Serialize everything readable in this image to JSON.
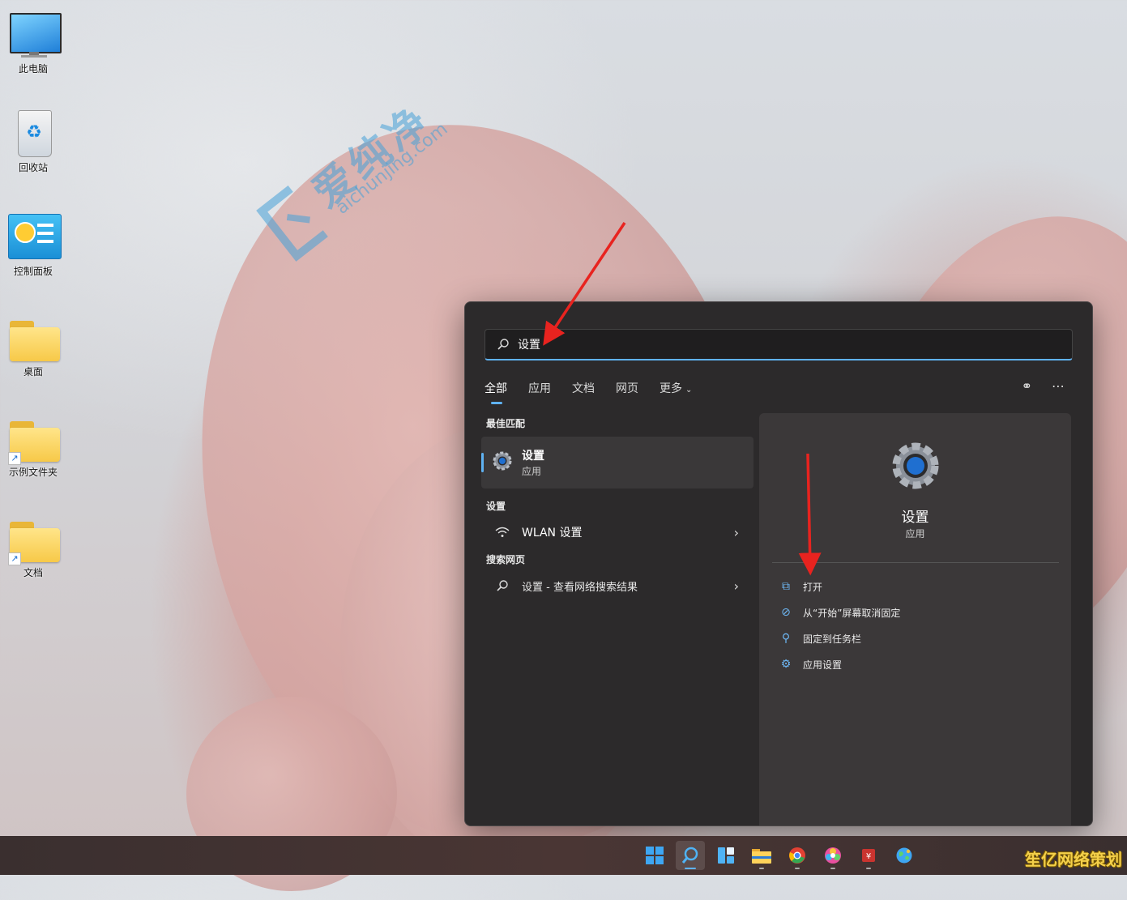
{
  "desktop": {
    "icons": [
      {
        "label": "此电脑",
        "icon": "monitor-icon"
      },
      {
        "label": "回收站",
        "icon": "recycle-bin-icon"
      },
      {
        "label": "控制面板",
        "icon": "control-panel-icon"
      },
      {
        "label": "桌面",
        "icon": "folder-icon"
      },
      {
        "label": "示例文件夹",
        "icon": "folder-shortcut-icon"
      },
      {
        "label": "文档",
        "icon": "folder-shortcut-icon"
      }
    ]
  },
  "watermark": {
    "title": "爱纯净",
    "subtitle": "aichunjing.com"
  },
  "search": {
    "query": "设置",
    "tabs": [
      "全部",
      "应用",
      "文档",
      "网页",
      "更多"
    ],
    "active_tab": "全部",
    "sections": {
      "best_match": {
        "heading": "最佳匹配",
        "title": "设置",
        "subtitle": "应用"
      },
      "settings": {
        "heading": "设置",
        "item": "WLAN 设置"
      },
      "web": {
        "heading": "搜索网页",
        "item": "设置 - 查看网络搜索结果"
      }
    },
    "detail": {
      "title": "设置",
      "subtitle": "应用",
      "actions": [
        {
          "label": "打开",
          "icon": "open-external-icon"
        },
        {
          "label": "从“开始”屏幕取消固定",
          "icon": "unpin-icon"
        },
        {
          "label": "固定到任务栏",
          "icon": "pin-icon"
        },
        {
          "label": "应用设置",
          "icon": "gear-icon"
        }
      ]
    }
  },
  "taskbar": {
    "icons": [
      "windows-start-icon",
      "search-icon",
      "widgets-icon",
      "file-explorer-icon",
      "chrome-icon",
      "photos-icon",
      "app-icon",
      "globe-icon"
    ],
    "corner_text": "笙亿网络策划"
  },
  "colors": {
    "accent": "#5fb2f2",
    "flyout_bg": "#2c2a2b",
    "arrow": "#e8231f"
  }
}
